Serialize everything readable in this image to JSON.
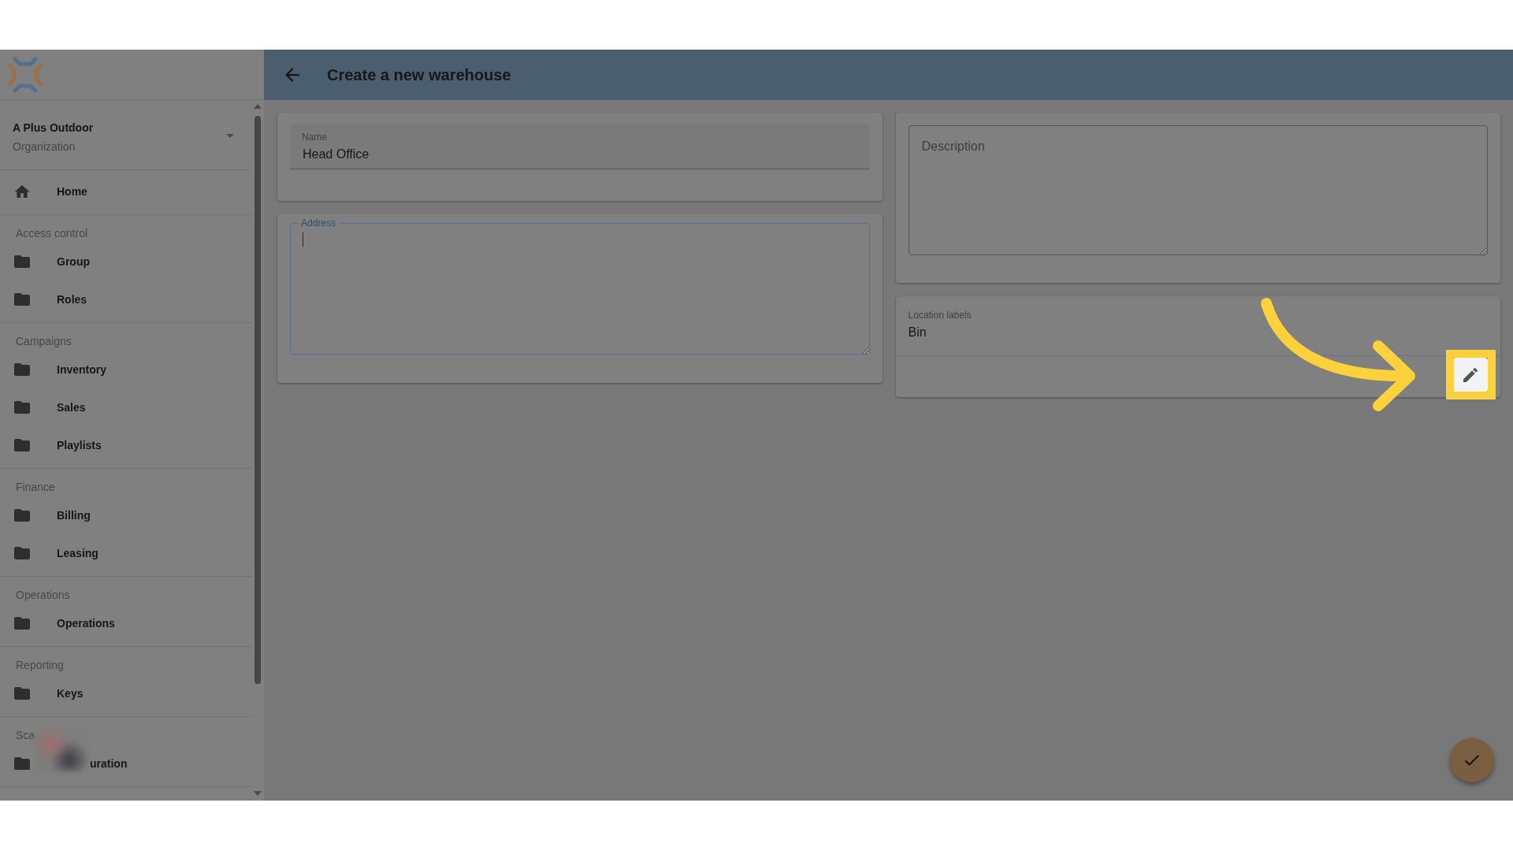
{
  "sidebar": {
    "organization": {
      "name": "A Plus Outdoor",
      "type": "Organization"
    },
    "sections": [
      {
        "items": [
          {
            "label": "Home",
            "kind": "home"
          }
        ]
      },
      {
        "title": "Access control",
        "items": [
          {
            "label": "Group",
            "kind": "folder"
          },
          {
            "label": "Roles",
            "kind": "folder"
          }
        ]
      },
      {
        "title": "Campaigns",
        "items": [
          {
            "label": "Inventory",
            "kind": "folder"
          },
          {
            "label": "Sales",
            "kind": "folder"
          },
          {
            "label": "Playlists",
            "kind": "folder"
          }
        ]
      },
      {
        "title": "Finance",
        "items": [
          {
            "label": "Billing",
            "kind": "folder"
          },
          {
            "label": "Leasing",
            "kind": "folder"
          }
        ]
      },
      {
        "title": "Operations",
        "items": [
          {
            "label": "Operations",
            "kind": "folder"
          }
        ]
      },
      {
        "title": "Reporting",
        "items": [
          {
            "label": "Keys",
            "kind": "folder"
          }
        ]
      },
      {
        "title": "Sca",
        "items": [
          {
            "label": "uration",
            "kind": "obscured"
          }
        ]
      }
    ]
  },
  "header": {
    "title": "Create a new warehouse"
  },
  "form": {
    "name": {
      "label": "Name",
      "value": "Head Office"
    },
    "address": {
      "label": "Address",
      "focused": true
    },
    "description": {
      "placeholder": "Description"
    },
    "location_labels": {
      "label": "Location labels",
      "value": "Bin",
      "edit_button": {
        "highlighted": true
      }
    }
  }
}
